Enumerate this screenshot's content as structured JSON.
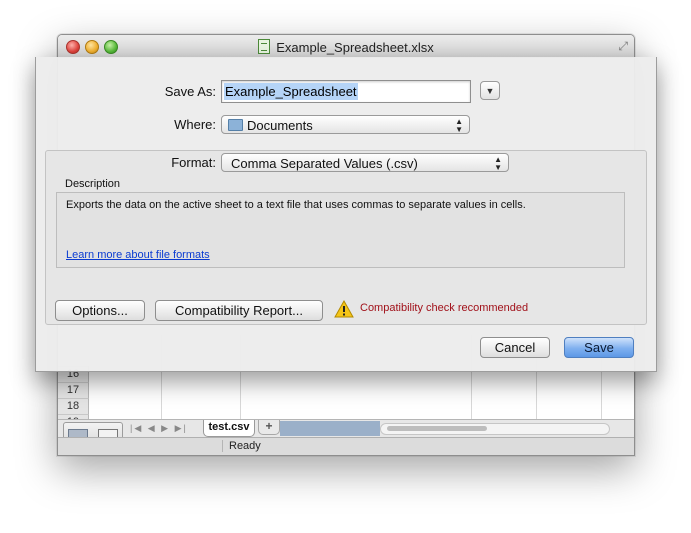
{
  "window": {
    "title": "Example_Spreadsheet.xlsx",
    "row_numbers": [
      "16",
      "17",
      "18",
      "19"
    ]
  },
  "sheet_tabs": {
    "active": "test.csv",
    "add_label": "+"
  },
  "status": {
    "text": "Ready"
  },
  "save_dialog": {
    "save_as_label": "Save As:",
    "filename": "Example_Spreadsheet",
    "where_label": "Where:",
    "where_value": "Documents",
    "format_label": "Format:",
    "format_value": "Comma Separated Values (.csv)",
    "description_label": "Description",
    "description_text": "Exports the data on the active sheet to a text file that uses commas to separate values in cells.",
    "learn_more_link": "Learn more about file formats",
    "options_button": "Options...",
    "compatibility_button": "Compatibility Report...",
    "compatibility_warning": "Compatibility check recommended",
    "cancel_button": "Cancel",
    "save_button": "Save"
  },
  "colors": {
    "link": "#0a3bd1",
    "warning_text": "#a1111a",
    "default_button": "#7fb0ef",
    "selection": "#b5d4f7"
  },
  "icons": [
    "close-light",
    "minimize-light",
    "zoom-light",
    "document-icon",
    "fullscreen-icon",
    "folder-icon",
    "warning-icon",
    "disclosure-icon",
    "normal-view-icon",
    "page-layout-view-icon"
  ]
}
